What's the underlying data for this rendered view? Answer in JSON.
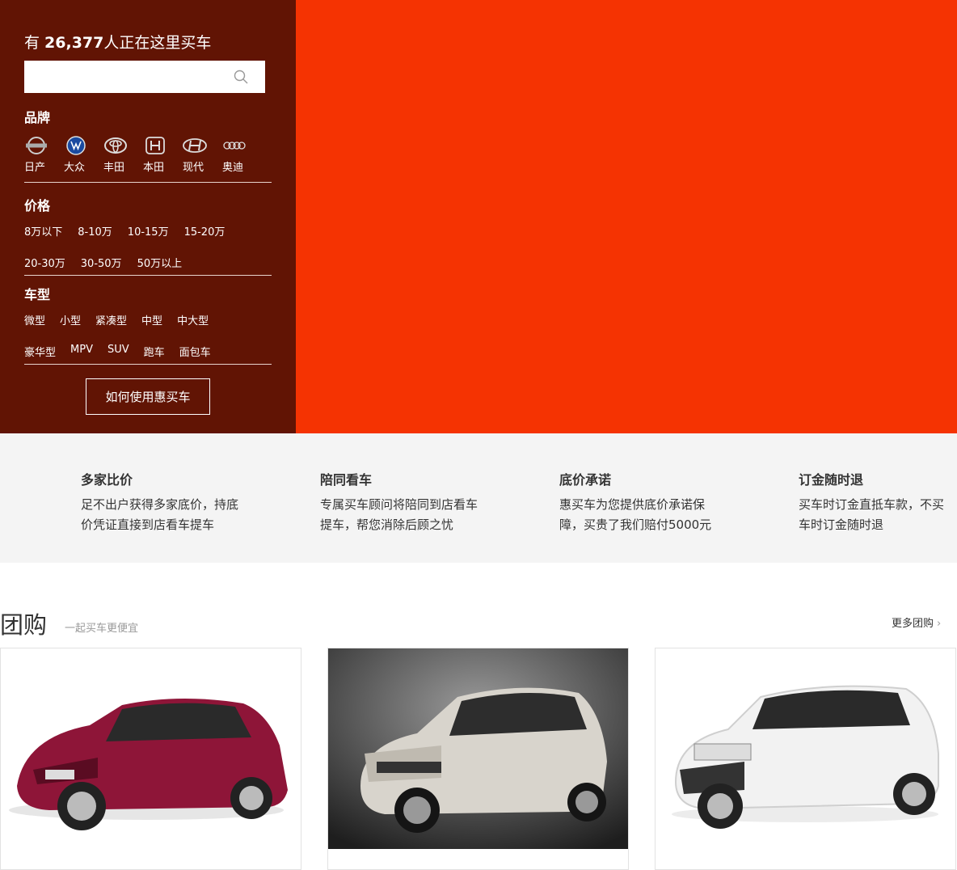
{
  "panel": {
    "headline_prefix": "有 ",
    "headline_count": "26,377",
    "headline_suffix": "人正在这里买车",
    "search_placeholder": "",
    "brand_title": "品牌",
    "brands": [
      {
        "label": "日产",
        "icon": "nissan-logo-icon"
      },
      {
        "label": "大众",
        "icon": "volkswagen-logo-icon"
      },
      {
        "label": "丰田",
        "icon": "toyota-logo-icon"
      },
      {
        "label": "本田",
        "icon": "honda-logo-icon"
      },
      {
        "label": "现代",
        "icon": "hyundai-logo-icon"
      },
      {
        "label": "奥迪",
        "icon": "audi-logo-icon"
      }
    ],
    "price_title": "价格",
    "prices_row1": [
      "8万以下",
      "8-10万",
      "10-15万",
      "15-20万"
    ],
    "prices_row2": [
      "20-30万",
      "30-50万",
      "50万以上"
    ],
    "type_title": "车型",
    "types_row1": [
      "微型",
      "小型",
      "紧凑型",
      "中型",
      "中大型"
    ],
    "types_row2": [
      "豪华型",
      "MPV",
      "SUV",
      "跑车",
      "面包车"
    ],
    "howto_label": "如何使用惠买车"
  },
  "features": [
    {
      "title": "多家比价",
      "desc": "足不出户获得多家底价，持底价凭证直接到店看车提车"
    },
    {
      "title": "陪同看车",
      "desc": "专属买车顾问将陪同到店看车提车，帮您消除后顾之忧"
    },
    {
      "title": "底价承诺",
      "desc": "惠买车为您提供底价承诺保障，买贵了我们赔付5000元"
    },
    {
      "title": "订金随时退",
      "desc": "买车时订金直抵车款，不买车时订金随时退"
    }
  ],
  "group": {
    "title": "团购",
    "subtitle": "一起买车更便宜",
    "more_label": "更多团购"
  },
  "colors": {
    "panel_bg": "#611404",
    "hero_bg": "#f53302",
    "feature_bg": "#f4f4f4"
  }
}
